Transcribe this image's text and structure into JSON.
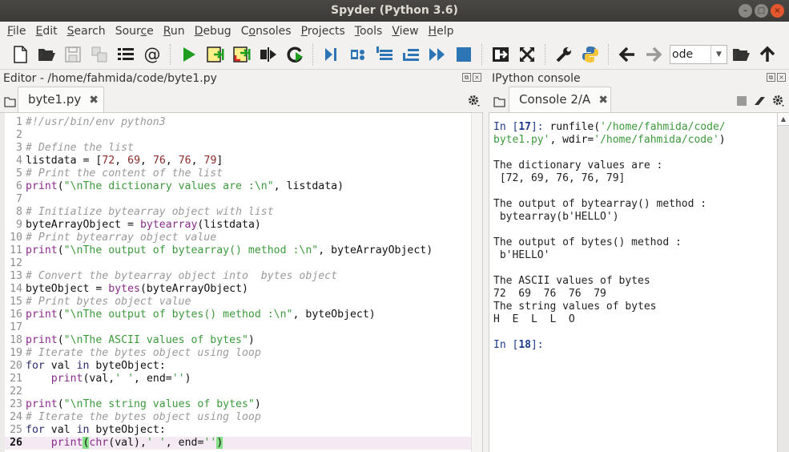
{
  "window": {
    "title": "Spyder (Python 3.6)",
    "buttons": [
      "minimize",
      "maximize",
      "close"
    ]
  },
  "menubar": {
    "items": [
      {
        "label": "File",
        "mnemonic": "F"
      },
      {
        "label": "Edit",
        "mnemonic": "E"
      },
      {
        "label": "Search",
        "mnemonic": "S"
      },
      {
        "label": "Source",
        "mnemonic": "c"
      },
      {
        "label": "Run",
        "mnemonic": "R"
      },
      {
        "label": "Debug",
        "mnemonic": "D"
      },
      {
        "label": "Consoles",
        "mnemonic": "o"
      },
      {
        "label": "Projects",
        "mnemonic": "P"
      },
      {
        "label": "Tools",
        "mnemonic": "T"
      },
      {
        "label": "View",
        "mnemonic": "V"
      },
      {
        "label": "Help",
        "mnemonic": "H"
      }
    ]
  },
  "toolbar": {
    "icons": [
      "new-file",
      "open-file",
      "save-file",
      "save-all",
      "outline-list",
      "at-sign",
      "run",
      "run-cell",
      "run-cell-advance",
      "run-selection",
      "rerun",
      "debug",
      "debug-step",
      "debug-step-into",
      "debug-step-return",
      "debug-continue",
      "debug-stop",
      "maximize-pane",
      "fullscreen",
      "preferences",
      "python-path",
      "back",
      "forward"
    ],
    "cwd_value": "ode"
  },
  "editor": {
    "title": "Editor - /home/fahmida/code/byte1.py",
    "tab_label": "byte1.py",
    "current_line": 26,
    "lines": [
      "#!/usr/bin/env python3",
      "",
      "# Define the list",
      "listdata = [72, 69, 76, 76, 79]",
      "# Print the content of the list",
      "print(\"\\nThe dictionary values are :\\n\", listdata)",
      "",
      "# Initialize bytearray object with list",
      "byteArrayObject = bytearray(listdata)",
      "# Print bytearray object value",
      "print(\"\\nThe output of bytearray() method :\\n\", byteArrayObject)",
      "",
      "# Convert the bytearray object into  bytes object",
      "byteObject = bytes(byteArrayObject)",
      "# Print bytes object value",
      "print(\"\\nThe output of bytes() method :\\n\", byteObject)",
      "",
      "print(\"\\nThe ASCII values of bytes\")",
      "# Iterate the bytes object using loop",
      "for val in byteObject:",
      "    print(val,' ', end='')",
      "",
      "print(\"\\nThe string values of bytes\")",
      "# Iterate the bytes object using loop",
      "for val in byteObject:",
      "    print(chr(val),' ', end='')"
    ]
  },
  "console": {
    "title": "IPython console",
    "tab_label": "Console 2/A",
    "prompt_in_17": "17",
    "prompt_in_18": "18",
    "runfile_path": "'/home/fahmida/code/",
    "runfile_path2": "byte1.py'",
    "wdir": "'/home/fahmida/code'",
    "output": [
      "The dictionary values are :",
      " [72, 69, 76, 76, 79]",
      "",
      "The output of bytearray() method :",
      " bytearray(b'HELLO')",
      "",
      "The output of bytes() method :",
      " b'HELLO'",
      "",
      "The ASCII values of bytes",
      "72  69  76  76  79",
      "The string values of bytes",
      "H  E  L  L  O"
    ]
  }
}
